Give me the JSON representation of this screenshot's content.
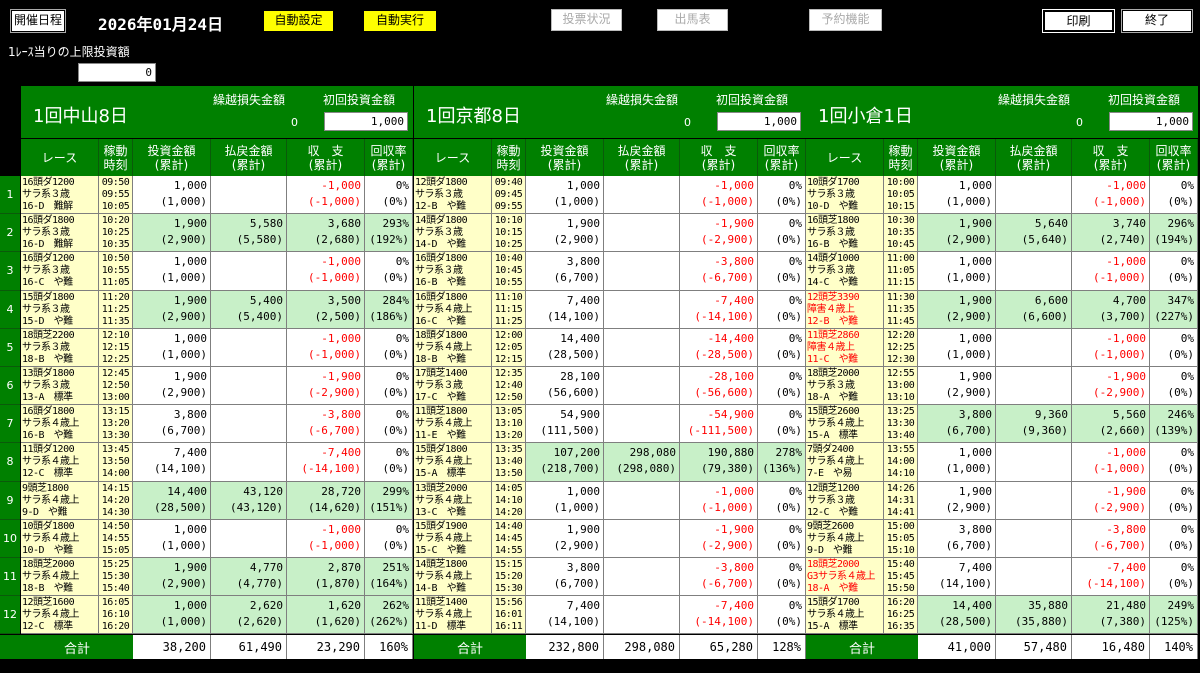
{
  "toolbar": {
    "kaisai_btn": "開催日程",
    "date": "2026年01月24日",
    "auto_settings": "自動設定",
    "auto_run": "自動実行",
    "vote_status": "投票状況",
    "entries": "出馬表",
    "reserve": "予約機能",
    "print": "印刷",
    "exit": "終了"
  },
  "limit": {
    "label": "1ﾚｰｽ当りの上限投資額",
    "value": "0"
  },
  "columns": {
    "race": "レース",
    "time": "稼動\n時刻",
    "invest": "投資金額\n(累計)",
    "payout": "払戻金額\n(累計)",
    "balance": "収　支\n(累計)",
    "rate": "回収率\n(累計)"
  },
  "headers_labels": {
    "kurikoshi": "繰越損失金額",
    "shokai": "初回投資金額"
  },
  "total_label": "合計",
  "row_numbers": [
    "1",
    "2",
    "3",
    "4",
    "5",
    "6",
    "7",
    "8",
    "9",
    "10",
    "11",
    "12"
  ],
  "venues": [
    {
      "name": "1回中山8日",
      "kurikoshi": "0",
      "shokai": "1,000",
      "rows": [
        {
          "race": [
            "16頭ダ1200",
            "サラ系３歳",
            "16-D　難解"
          ],
          "red": false,
          "time": [
            "09:50",
            "09:55",
            "10:05"
          ],
          "invest": "1,000",
          "invest_c": "(1,000)",
          "payout": "",
          "payout_c": "",
          "bal": "-1,000",
          "bal_c": "(-1,000)",
          "rate": "0%",
          "rate_c": "(0%)",
          "green": false
        },
        {
          "race": [
            "16頭ダ1800",
            "サラ系３歳",
            "16-D　難解"
          ],
          "red": false,
          "time": [
            "10:20",
            "10:25",
            "10:35"
          ],
          "invest": "1,900",
          "invest_c": "(2,900)",
          "payout": "5,580",
          "payout_c": "(5,580)",
          "bal": "3,680",
          "bal_c": "(2,680)",
          "rate": "293%",
          "rate_c": "(192%)",
          "green": true
        },
        {
          "race": [
            "16頭ダ1200",
            "サラ系３歳",
            "16-C　や難"
          ],
          "red": false,
          "time": [
            "10:50",
            "10:55",
            "11:05"
          ],
          "invest": "1,000",
          "invest_c": "(1,000)",
          "payout": "",
          "payout_c": "",
          "bal": "-1,000",
          "bal_c": "(-1,000)",
          "rate": "0%",
          "rate_c": "(0%)",
          "green": false
        },
        {
          "race": [
            "15頭ダ1800",
            "サラ系３歳",
            "15-D　や難"
          ],
          "red": false,
          "time": [
            "11:20",
            "11:25",
            "11:35"
          ],
          "invest": "1,900",
          "invest_c": "(2,900)",
          "payout": "5,400",
          "payout_c": "(5,400)",
          "bal": "3,500",
          "bal_c": "(2,500)",
          "rate": "284%",
          "rate_c": "(186%)",
          "green": true
        },
        {
          "race": [
            "18頭芝2200",
            "サラ系３歳",
            "18-B　や難"
          ],
          "red": false,
          "time": [
            "12:10",
            "12:15",
            "12:25"
          ],
          "invest": "1,000",
          "invest_c": "(1,000)",
          "payout": "",
          "payout_c": "",
          "bal": "-1,000",
          "bal_c": "(-1,000)",
          "rate": "0%",
          "rate_c": "(0%)",
          "green": false
        },
        {
          "race": [
            "13頭ダ1800",
            "サラ系３歳",
            "13-A　標準"
          ],
          "red": false,
          "time": [
            "12:45",
            "12:50",
            "13:00"
          ],
          "invest": "1,900",
          "invest_c": "(2,900)",
          "payout": "",
          "payout_c": "",
          "bal": "-1,900",
          "bal_c": "(-2,900)",
          "rate": "0%",
          "rate_c": "(0%)",
          "green": false
        },
        {
          "race": [
            "16頭ダ1800",
            "サラ系４歳上",
            "16-B　や難"
          ],
          "red": false,
          "time": [
            "13:15",
            "13:20",
            "13:30"
          ],
          "invest": "3,800",
          "invest_c": "(6,700)",
          "payout": "",
          "payout_c": "",
          "bal": "-3,800",
          "bal_c": "(-6,700)",
          "rate": "0%",
          "rate_c": "(0%)",
          "green": false
        },
        {
          "race": [
            "11頭ダ1200",
            "サラ系４歳上",
            "12-C　標準"
          ],
          "red": false,
          "time": [
            "13:45",
            "13:50",
            "14:00"
          ],
          "invest": "7,400",
          "invest_c": "(14,100)",
          "payout": "",
          "payout_c": "",
          "bal": "-7,400",
          "bal_c": "(-14,100)",
          "rate": "0%",
          "rate_c": "(0%)",
          "green": false
        },
        {
          "race": [
            "9頭芝1800",
            "サラ系４歳上",
            "9-D　や難"
          ],
          "red": false,
          "time": [
            "14:15",
            "14:20",
            "14:30"
          ],
          "invest": "14,400",
          "invest_c": "(28,500)",
          "payout": "43,120",
          "payout_c": "(43,120)",
          "bal": "28,720",
          "bal_c": "(14,620)",
          "rate": "299%",
          "rate_c": "(151%)",
          "green": true
        },
        {
          "race": [
            "10頭ダ1800",
            "サラ系４歳上",
            "10-D　や難"
          ],
          "red": false,
          "time": [
            "14:50",
            "14:55",
            "15:05"
          ],
          "invest": "1,000",
          "invest_c": "(1,000)",
          "payout": "",
          "payout_c": "",
          "bal": "-1,000",
          "bal_c": "(-1,000)",
          "rate": "0%",
          "rate_c": "(0%)",
          "green": false
        },
        {
          "race": [
            "18頭芝2000",
            "サラ系４歳上",
            "18-B　や難"
          ],
          "red": false,
          "time": [
            "15:25",
            "15:30",
            "15:40"
          ],
          "invest": "1,900",
          "invest_c": "(2,900)",
          "payout": "4,770",
          "payout_c": "(4,770)",
          "bal": "2,870",
          "bal_c": "(1,870)",
          "rate": "251%",
          "rate_c": "(164%)",
          "green": true
        },
        {
          "race": [
            "12頭芝1600",
            "サラ系４歳上",
            "12-C　標準"
          ],
          "red": false,
          "time": [
            "16:05",
            "16:10",
            "16:20"
          ],
          "invest": "1,000",
          "invest_c": "(1,000)",
          "payout": "2,620",
          "payout_c": "(2,620)",
          "bal": "1,620",
          "bal_c": "(1,620)",
          "rate": "262%",
          "rate_c": "(262%)",
          "green": true
        }
      ],
      "totals": {
        "invest": "38,200",
        "payout": "61,490",
        "bal": "23,290",
        "rate": "160%"
      }
    },
    {
      "name": "1回京都8日",
      "kurikoshi": "0",
      "shokai": "1,000",
      "rows": [
        {
          "race": [
            "12頭ダ1800",
            "サラ系３歳",
            "12-B　や難"
          ],
          "red": false,
          "time": [
            "09:40",
            "09:45",
            "09:55"
          ],
          "invest": "1,000",
          "invest_c": "(1,000)",
          "payout": "",
          "payout_c": "",
          "bal": "-1,000",
          "bal_c": "(-1,000)",
          "rate": "0%",
          "rate_c": "(0%)",
          "green": false
        },
        {
          "race": [
            "14頭ダ1800",
            "サラ系３歳",
            "14-D　や難"
          ],
          "red": false,
          "time": [
            "10:10",
            "10:15",
            "10:25"
          ],
          "invest": "1,900",
          "invest_c": "(2,900)",
          "payout": "",
          "payout_c": "",
          "bal": "-1,900",
          "bal_c": "(-2,900)",
          "rate": "0%",
          "rate_c": "(0%)",
          "green": false
        },
        {
          "race": [
            "16頭ダ1800",
            "サラ系３歳",
            "16-B　や難"
          ],
          "red": false,
          "time": [
            "10:40",
            "10:45",
            "10:55"
          ],
          "invest": "3,800",
          "invest_c": "(6,700)",
          "payout": "",
          "payout_c": "",
          "bal": "-3,800",
          "bal_c": "(-6,700)",
          "rate": "0%",
          "rate_c": "(0%)",
          "green": false
        },
        {
          "race": [
            "16頭ダ1800",
            "サラ系４歳上",
            "16-C　や難"
          ],
          "red": false,
          "time": [
            "11:10",
            "11:15",
            "11:25"
          ],
          "invest": "7,400",
          "invest_c": "(14,100)",
          "payout": "",
          "payout_c": "",
          "bal": "-7,400",
          "bal_c": "(-14,100)",
          "rate": "0%",
          "rate_c": "(0%)",
          "green": false
        },
        {
          "race": [
            "18頭ダ1800",
            "サラ系４歳上",
            "18-B　や難"
          ],
          "red": false,
          "time": [
            "12:00",
            "12:05",
            "12:15"
          ],
          "invest": "14,400",
          "invest_c": "(28,500)",
          "payout": "",
          "payout_c": "",
          "bal": "-14,400",
          "bal_c": "(-28,500)",
          "rate": "0%",
          "rate_c": "(0%)",
          "green": false
        },
        {
          "race": [
            "17頭芝1400",
            "サラ系３歳",
            "17-C　や難"
          ],
          "red": false,
          "time": [
            "12:35",
            "12:40",
            "12:50"
          ],
          "invest": "28,100",
          "invest_c": "(56,600)",
          "payout": "",
          "payout_c": "",
          "bal": "-28,100",
          "bal_c": "(-56,600)",
          "rate": "0%",
          "rate_c": "(0%)",
          "green": false
        },
        {
          "race": [
            "11頭芝1800",
            "サラ系４歳上",
            "11-E　や難"
          ],
          "red": false,
          "time": [
            "13:05",
            "13:10",
            "13:20"
          ],
          "invest": "54,900",
          "invest_c": "(111,500)",
          "payout": "",
          "payout_c": "",
          "bal": "-54,900",
          "bal_c": "(-111,500)",
          "rate": "0%",
          "rate_c": "(0%)",
          "green": false
        },
        {
          "race": [
            "15頭ダ1800",
            "サラ系４歳上",
            "15-A　標準"
          ],
          "red": false,
          "time": [
            "13:35",
            "13:40",
            "13:50"
          ],
          "invest": "107,200",
          "invest_c": "(218,700)",
          "payout": "298,080",
          "payout_c": "(298,080)",
          "bal": "190,880",
          "bal_c": "(79,380)",
          "rate": "278%",
          "rate_c": "(136%)",
          "green": true
        },
        {
          "race": [
            "13頭芝2000",
            "サラ系４歳上",
            "13-C　や難"
          ],
          "red": false,
          "time": [
            "14:05",
            "14:10",
            "14:20"
          ],
          "invest": "1,000",
          "invest_c": "(1,000)",
          "payout": "",
          "payout_c": "",
          "bal": "-1,000",
          "bal_c": "(-1,000)",
          "rate": "0%",
          "rate_c": "(0%)",
          "green": false
        },
        {
          "race": [
            "15頭ダ1900",
            "サラ系４歳上",
            "15-C　や難"
          ],
          "red": false,
          "time": [
            "14:40",
            "14:45",
            "14:55"
          ],
          "invest": "1,900",
          "invest_c": "(2,900)",
          "payout": "",
          "payout_c": "",
          "bal": "-1,900",
          "bal_c": "(-2,900)",
          "rate": "0%",
          "rate_c": "(0%)",
          "green": false
        },
        {
          "race": [
            "14頭芝1800",
            "サラ系４歳上",
            "14-B　や難"
          ],
          "red": false,
          "time": [
            "15:15",
            "15:20",
            "15:30"
          ],
          "invest": "3,800",
          "invest_c": "(6,700)",
          "payout": "",
          "payout_c": "",
          "bal": "-3,800",
          "bal_c": "(-6,700)",
          "rate": "0%",
          "rate_c": "(0%)",
          "green": false
        },
        {
          "race": [
            "11頭芝1400",
            "サラ系４歳上",
            "11-D　標準"
          ],
          "red": false,
          "time": [
            "15:56",
            "16:01",
            "16:11"
          ],
          "invest": "7,400",
          "invest_c": "(14,100)",
          "payout": "",
          "payout_c": "",
          "bal": "-7,400",
          "bal_c": "(-14,100)",
          "rate": "0%",
          "rate_c": "(0%)",
          "green": false
        }
      ],
      "totals": {
        "invest": "232,800",
        "payout": "298,080",
        "bal": "65,280",
        "rate": "128%"
      }
    },
    {
      "name": "1回小倉1日",
      "kurikoshi": "0",
      "shokai": "1,000",
      "rows": [
        {
          "race": [
            "10頭ダ1700",
            "サラ系３歳",
            "10-D　や難"
          ],
          "red": false,
          "time": [
            "10:00",
            "10:05",
            "10:15"
          ],
          "invest": "1,000",
          "invest_c": "(1,000)",
          "payout": "",
          "payout_c": "",
          "bal": "-1,000",
          "bal_c": "(-1,000)",
          "rate": "0%",
          "rate_c": "(0%)",
          "green": false
        },
        {
          "race": [
            "16頭芝1800",
            "サラ系３歳",
            "16-B　や難"
          ],
          "red": false,
          "time": [
            "10:30",
            "10:35",
            "10:45"
          ],
          "invest": "1,900",
          "invest_c": "(2,900)",
          "payout": "5,640",
          "payout_c": "(5,640)",
          "bal": "3,740",
          "bal_c": "(2,740)",
          "rate": "296%",
          "rate_c": "(194%)",
          "green": true
        },
        {
          "race": [
            "14頭ダ1000",
            "サラ系３歳",
            "14-C　や難"
          ],
          "red": false,
          "time": [
            "11:00",
            "11:05",
            "11:15"
          ],
          "invest": "1,000",
          "invest_c": "(1,000)",
          "payout": "",
          "payout_c": "",
          "bal": "-1,000",
          "bal_c": "(-1,000)",
          "rate": "0%",
          "rate_c": "(0%)",
          "green": false
        },
        {
          "race": [
            "12頭芝3390",
            "障害４歳上",
            "12-B　や難"
          ],
          "red": true,
          "time": [
            "11:30",
            "11:35",
            "11:45"
          ],
          "invest": "1,900",
          "invest_c": "(2,900)",
          "payout": "6,600",
          "payout_c": "(6,600)",
          "bal": "4,700",
          "bal_c": "(3,700)",
          "rate": "347%",
          "rate_c": "(227%)",
          "green": true
        },
        {
          "race": [
            "11頭芝2860",
            "障害４歳上",
            "11-C　や難"
          ],
          "red": true,
          "time": [
            "12:20",
            "12:25",
            "12:30"
          ],
          "invest": "1,000",
          "invest_c": "(1,000)",
          "payout": "",
          "payout_c": "",
          "bal": "-1,000",
          "bal_c": "(-1,000)",
          "rate": "0%",
          "rate_c": "(0%)",
          "green": false
        },
        {
          "race": [
            "18頭芝2000",
            "サラ系３歳",
            "18-A　や難"
          ],
          "red": false,
          "time": [
            "12:55",
            "13:00",
            "13:10"
          ],
          "invest": "1,900",
          "invest_c": "(2,900)",
          "payout": "",
          "payout_c": "",
          "bal": "-1,900",
          "bal_c": "(-2,900)",
          "rate": "0%",
          "rate_c": "(0%)",
          "green": false
        },
        {
          "race": [
            "15頭芝2600",
            "サラ系４歳上",
            "15-A　標準"
          ],
          "red": false,
          "time": [
            "13:25",
            "13:30",
            "13:40"
          ],
          "invest": "3,800",
          "invest_c": "(6,700)",
          "payout": "9,360",
          "payout_c": "(9,360)",
          "bal": "5,560",
          "bal_c": "(2,660)",
          "rate": "246%",
          "rate_c": "(139%)",
          "green": true
        },
        {
          "race": [
            "7頭ダ2400",
            "サラ系４歳上",
            "7-E　や易"
          ],
          "red": false,
          "time": [
            "13:55",
            "14:00",
            "14:10"
          ],
          "invest": "1,000",
          "invest_c": "(1,000)",
          "payout": "",
          "payout_c": "",
          "bal": "-1,000",
          "bal_c": "(-1,000)",
          "rate": "0%",
          "rate_c": "(0%)",
          "green": false
        },
        {
          "race": [
            "12頭芝1200",
            "サラ系３歳",
            "12-C　や難"
          ],
          "red": false,
          "time": [
            "14:26",
            "14:31",
            "14:41"
          ],
          "invest": "1,900",
          "invest_c": "(2,900)",
          "payout": "",
          "payout_c": "",
          "bal": "-1,900",
          "bal_c": "(-2,900)",
          "rate": "0%",
          "rate_c": "(0%)",
          "green": false
        },
        {
          "race": [
            "9頭芝2600",
            "サラ系４歳上",
            "9-D　や難"
          ],
          "red": false,
          "time": [
            "15:00",
            "15:05",
            "15:10"
          ],
          "invest": "3,800",
          "invest_c": "(6,700)",
          "payout": "",
          "payout_c": "",
          "bal": "-3,800",
          "bal_c": "(-6,700)",
          "rate": "0%",
          "rate_c": "(0%)",
          "green": false
        },
        {
          "race": [
            "18頭芝2000",
            "G3サラ系４歳上",
            "18-A　や難"
          ],
          "red": true,
          "time": [
            "15:40",
            "15:45",
            "15:50"
          ],
          "invest": "7,400",
          "invest_c": "(14,100)",
          "payout": "",
          "payout_c": "",
          "bal": "-7,400",
          "bal_c": "(-14,100)",
          "rate": "0%",
          "rate_c": "(0%)",
          "green": false
        },
        {
          "race": [
            "15頭ダ1700",
            "サラ系４歳上",
            "15-A　標準"
          ],
          "red": false,
          "time": [
            "16:20",
            "16:25",
            "16:35"
          ],
          "invest": "14,400",
          "invest_c": "(28,500)",
          "payout": "35,880",
          "payout_c": "(35,880)",
          "bal": "21,480",
          "bal_c": "(7,380)",
          "rate": "249%",
          "rate_c": "(125%)",
          "green": true
        }
      ],
      "totals": {
        "invest": "41,000",
        "payout": "57,480",
        "bal": "16,480",
        "rate": "140%"
      }
    }
  ]
}
